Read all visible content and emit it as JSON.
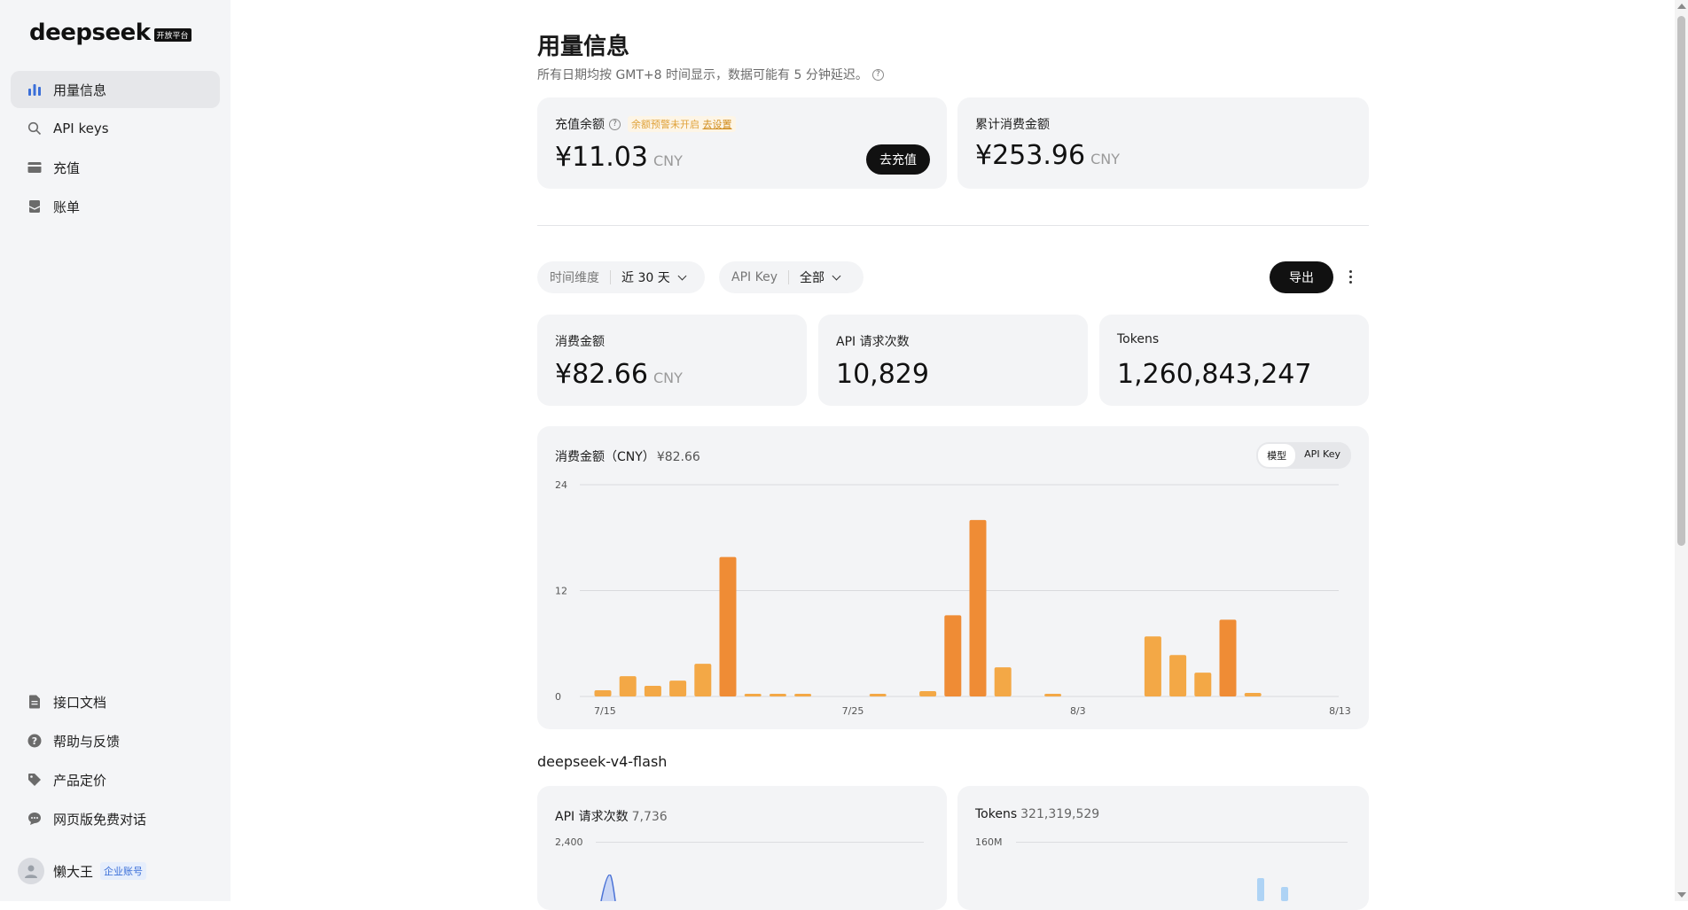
{
  "sidebar": {
    "logo": "deepseek",
    "logo_badge": "开放平台",
    "top_items": [
      {
        "label": "用量信息",
        "icon": "bar-chart-icon",
        "active": true
      },
      {
        "label": "API keys",
        "icon": "search-icon"
      },
      {
        "label": "充值",
        "icon": "credit-card-icon"
      },
      {
        "label": "账单",
        "icon": "bill-icon"
      }
    ],
    "bottom_items": [
      {
        "label": "接口文档",
        "icon": "document-icon"
      },
      {
        "label": "帮助与反馈",
        "icon": "help-icon"
      },
      {
        "label": "产品定价",
        "icon": "tag-icon"
      },
      {
        "label": "网页版免费对话",
        "icon": "chat-icon"
      }
    ],
    "user": {
      "name": "懒大王",
      "badge": "企业账号"
    }
  },
  "header": {
    "title": "用量信息",
    "subtitle": "所有日期均按 GMT+8 时间显示，数据可能有 5 分钟延迟。"
  },
  "balance": {
    "label": "充值余额",
    "warning": "余额预警未开启",
    "warning_link": "去设置",
    "amount": "¥11.03",
    "unit": "CNY",
    "button": "去充值"
  },
  "total_spend": {
    "label": "累计消费金额",
    "amount": "¥253.96",
    "unit": "CNY"
  },
  "filters": {
    "time_label": "时间维度",
    "time_value": "近 30 天",
    "key_label": "API Key",
    "key_value": "全部",
    "export": "导出"
  },
  "stats": {
    "spend_label": "消费金额",
    "spend_value": "¥82.66",
    "spend_unit": "CNY",
    "requests_label": "API 请求次数",
    "requests_value": "10,829",
    "tokens_label": "Tokens",
    "tokens_value": "1,260,843,247"
  },
  "chart": {
    "title": "消费金额（CNY）",
    "total": "¥82.66",
    "toggle": [
      "模型",
      "API Key"
    ],
    "color": "#ef8c35",
    "color_light": "#f3a846"
  },
  "chart_data": {
    "type": "bar",
    "categories": [
      "7/15",
      "7/16",
      "7/17",
      "7/18",
      "7/19",
      "7/20",
      "7/21",
      "7/22",
      "7/23",
      "7/24",
      "7/25",
      "7/26",
      "7/27",
      "7/28",
      "7/29",
      "7/30",
      "7/31",
      "8/1",
      "8/2",
      "8/3",
      "8/4",
      "8/5",
      "8/6",
      "8/7",
      "8/8",
      "8/9",
      "8/10",
      "8/11",
      "8/12",
      "8/13"
    ],
    "values": [
      0.7,
      2.3,
      1.2,
      1.8,
      3.7,
      15.8,
      0.3,
      0.3,
      0.3,
      0,
      0,
      0.3,
      0,
      0.6,
      9.2,
      20,
      3.3,
      0,
      0.3,
      0,
      0,
      0,
      6.8,
      4.7,
      2.7,
      8.7,
      0.4,
      0,
      0,
      0
    ],
    "x_tick_labels": [
      "7/15",
      "7/25",
      "8/3",
      "8/13"
    ],
    "y_tick_labels": [
      "0",
      "12",
      "24"
    ],
    "ylim": [
      0,
      24
    ],
    "grid": true
  },
  "model_section": {
    "title": "deepseek-v4-flash",
    "requests_label": "API 请求次数",
    "requests_value": "7,736",
    "requests_tick": "2,400",
    "tokens_label": "Tokens",
    "tokens_value": "321,319,529",
    "tokens_tick": "160M"
  }
}
